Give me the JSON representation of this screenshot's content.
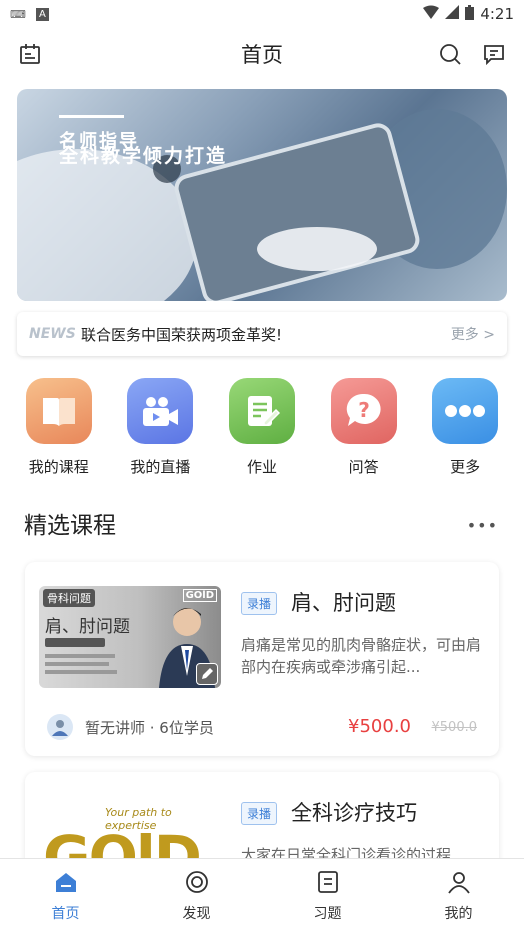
{
  "status_bar": {
    "time": "4:21",
    "badge": "A"
  },
  "header": {
    "title": "首页"
  },
  "banner": {
    "line1": "名师指导",
    "line2": "全科教学倾力打造"
  },
  "news": {
    "tag": "NEWS",
    "text": "联合医务中国荣获两项金革奖!",
    "more": "更多 >"
  },
  "quick_menu": [
    {
      "label": "我的课程",
      "icon": "book-icon",
      "color": "#f0a070"
    },
    {
      "label": "我的直播",
      "icon": "video-camera-icon",
      "color": "#6f8ef0"
    },
    {
      "label": "作业",
      "icon": "homework-icon",
      "color": "#7cc45c"
    },
    {
      "label": "问答",
      "icon": "question-bubble-icon",
      "color": "#ee7b78"
    },
    {
      "label": "更多",
      "icon": "more-dots-icon",
      "color": "#4aa2ee"
    }
  ],
  "section": {
    "title": "精选课程",
    "more": "•••"
  },
  "courses": [
    {
      "tag": "录播",
      "title": "肩、肘问题",
      "desc": "肩痛是常见的肌肉骨骼症状，可由肩部内在疾病或牵涉痛引起...",
      "teacher": "暂无讲师 · 6位学员",
      "price": "¥500.0",
      "old_price": "¥500.0",
      "thumb_label": "骨科问题",
      "thumb_title": "肩、肘问题",
      "thumb_brand": "GOlD"
    },
    {
      "tag": "录播",
      "title": "全科诊疗技巧",
      "desc": "大家在日常全科门诊看诊的过程",
      "thumb_tagline": "Your path to expertise",
      "thumb_brand": "GOlD"
    }
  ],
  "bottom_nav": [
    {
      "label": "首页",
      "icon": "home-icon",
      "active": true
    },
    {
      "label": "发现",
      "icon": "discover-icon",
      "active": false
    },
    {
      "label": "习题",
      "icon": "exercise-icon",
      "active": false
    },
    {
      "label": "我的",
      "icon": "profile-icon",
      "active": false
    }
  ],
  "colors": {
    "accent": "#3d7fd6",
    "price": "#e84040"
  }
}
